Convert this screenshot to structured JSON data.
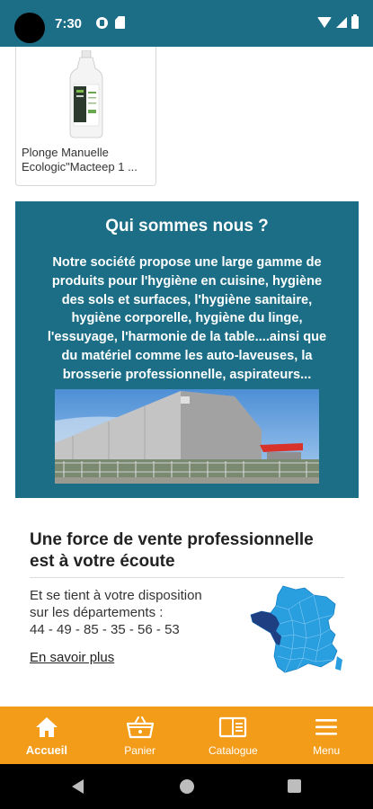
{
  "status_bar": {
    "time": "7:30"
  },
  "product": {
    "name_line1": "Plonge Manuelle",
    "name_line2": "Ecologic\"Macteep 1 ..."
  },
  "about": {
    "title": "Qui sommes nous ?",
    "lines": [
      "Notre société propose une large gamme de",
      "produits  pour l'hygiène en cuisine, hygiène",
      "des sols et surfaces, l'hygiène sanitaire,",
      "hygiène corporelle, hygiène du linge,",
      "l'essuyage, l'harmonie de la table....ainsi que",
      "du matériel comme les auto-laveuses, la",
      "brosserie professionnelle, aspirateurs..."
    ]
  },
  "sales": {
    "title_line1": "Une force de vente professionnelle",
    "title_line2": "est à votre écoute",
    "text_line1": "Et se tient à votre disposition",
    "text_line2": "sur les départements :",
    "departments": "44 - 49 - 85 - 35 - 56 - 53",
    "link": "En savoir plus"
  },
  "bottom_nav": {
    "items": [
      {
        "label": "Accueil",
        "icon": "home-icon",
        "active": true
      },
      {
        "label": "Panier",
        "icon": "basket-icon",
        "active": false
      },
      {
        "label": "Catalogue",
        "icon": "book-icon",
        "active": false
      },
      {
        "label": "Menu",
        "icon": "menu-icon",
        "active": false
      }
    ]
  },
  "colors": {
    "primary": "#1b6e86",
    "accent": "#f39c19",
    "map_highlight": "#1e3f82",
    "map_fill": "#2a9fe0"
  }
}
